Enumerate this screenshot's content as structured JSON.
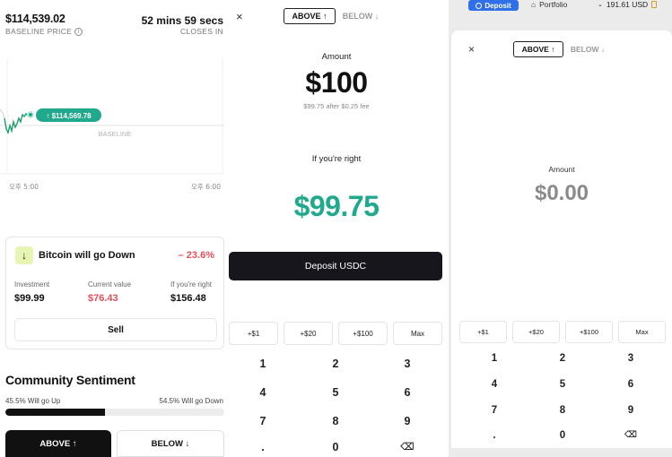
{
  "left": {
    "price": "$114,539.02",
    "price_label": "BASELINE PRICE",
    "timer": "52 mins 59 secs",
    "timer_label": "CLOSES IN",
    "chart_tag": "↑ $114,569.78",
    "baseline_label": "BASELINE",
    "time_start": "오후 5:00",
    "time_end": "오후 6:00",
    "position": {
      "title": "Bitcoin will go Down",
      "change": "– 23.6%",
      "investment_label": "Investment",
      "investment_value": "$99.99",
      "current_label": "Current value",
      "current_value": "$76.43",
      "right_label": "If you're right",
      "right_value": "$156.48",
      "sell_label": "Sell"
    },
    "sentiment": {
      "title": "Community Sentiment",
      "up_text": "45.5% Will go Up",
      "down_text": "54.5% Will go Down",
      "up_fraction": 0.455
    },
    "above_label": "ABOVE ↑",
    "below_label": "BELOW ↓"
  },
  "middle": {
    "close": "×",
    "toggle_above": "ABOVE ↑",
    "toggle_below": "BELOW ↓",
    "amount_label": "Amount",
    "amount": "$100",
    "fee_note": "$99.75 after $0.25 fee",
    "if_right_label": "If you're right",
    "payout": "$99.75",
    "deposit_label": "Deposit USDC",
    "quick": [
      "+$1",
      "+$20",
      "+$100",
      "Max"
    ],
    "keys": [
      "1",
      "2",
      "3",
      "4",
      "5",
      "6",
      "7",
      "8",
      "9",
      ".",
      "0",
      "⌫"
    ]
  },
  "right": {
    "deposit_label": "Deposit",
    "portfolio_label": "Portfolio",
    "balance": "191.61 USD",
    "close": "×",
    "toggle_above": "ABOVE ↑",
    "toggle_below": "BELOW ↓",
    "amount_label": "Amount",
    "amount": "$0.00",
    "quick": [
      "+$1",
      "+$20",
      "+$100",
      "Max"
    ],
    "keys": [
      "1",
      "2",
      "3",
      "4",
      "5",
      "6",
      "7",
      "8",
      "9",
      ".",
      "0",
      "⌫"
    ]
  },
  "colors": {
    "accent_green": "#20a98c",
    "loss_red": "#e0505a",
    "deposit_blue": "#2f6fe8",
    "dark_button": "#16161c",
    "badge_green": "#e7f5b3"
  }
}
